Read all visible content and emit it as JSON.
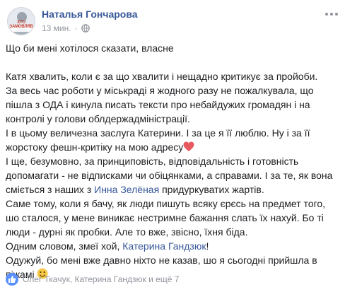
{
  "post": {
    "author": "Наталья Гончарова",
    "avatar_text": "ХТО ЗАМОВЛЯВ",
    "time": "13 мин.",
    "privacy_icon": "globe-icon",
    "more_icon": "ellipsis-icon",
    "paragraphs": [
      "Що би мені хотілося сказати, власне",
      "Катя хвалить, коли є за що хвалити і нещадно критикує за пройоби.",
      "За весь час роботи у міськраді я жодного разу не пожалкувала, що пішла з ОДА і кинула писать тексти про небайдужих громадян і на контролі у голови облдержадміністрації.",
      "І в цьому величезна заслуга Катерини. І за це я її люблю. Ну і за її жорстоку фешн-критіку на мою адресу",
      "І ще, безумовно, за принциповість, відповідальність і готовність допомагати - не відписками чи обіцянками, а справами. І за те, як вона сміється з наших з",
      "Инна Зелёная",
      "придуркуватих жартів.",
      "Саме тому, коли я бачу, як люди пишуть всяку єрєсь на предмет того, шо сталося, у мене виникає нестримне бажання слать їх нахуй. Бо ті люди - дурні як пробки. Але то вже, звісно, їхня біда.",
      "Одним словом, змеї хой,",
      "Катерина Гандзюк",
      "!",
      "Одужуй, бо мені вже давно ніхто не казав, шо я сьогодні прийшла в піжамі"
    ],
    "reactions": {
      "icon": "like-icon",
      "names": "Олег Ткачук, Катерина Гандзюк и ещё 7"
    },
    "colors": {
      "link": "#385898",
      "meta": "#90949c",
      "like": "#5890ff",
      "heart": "#e8595f"
    }
  }
}
